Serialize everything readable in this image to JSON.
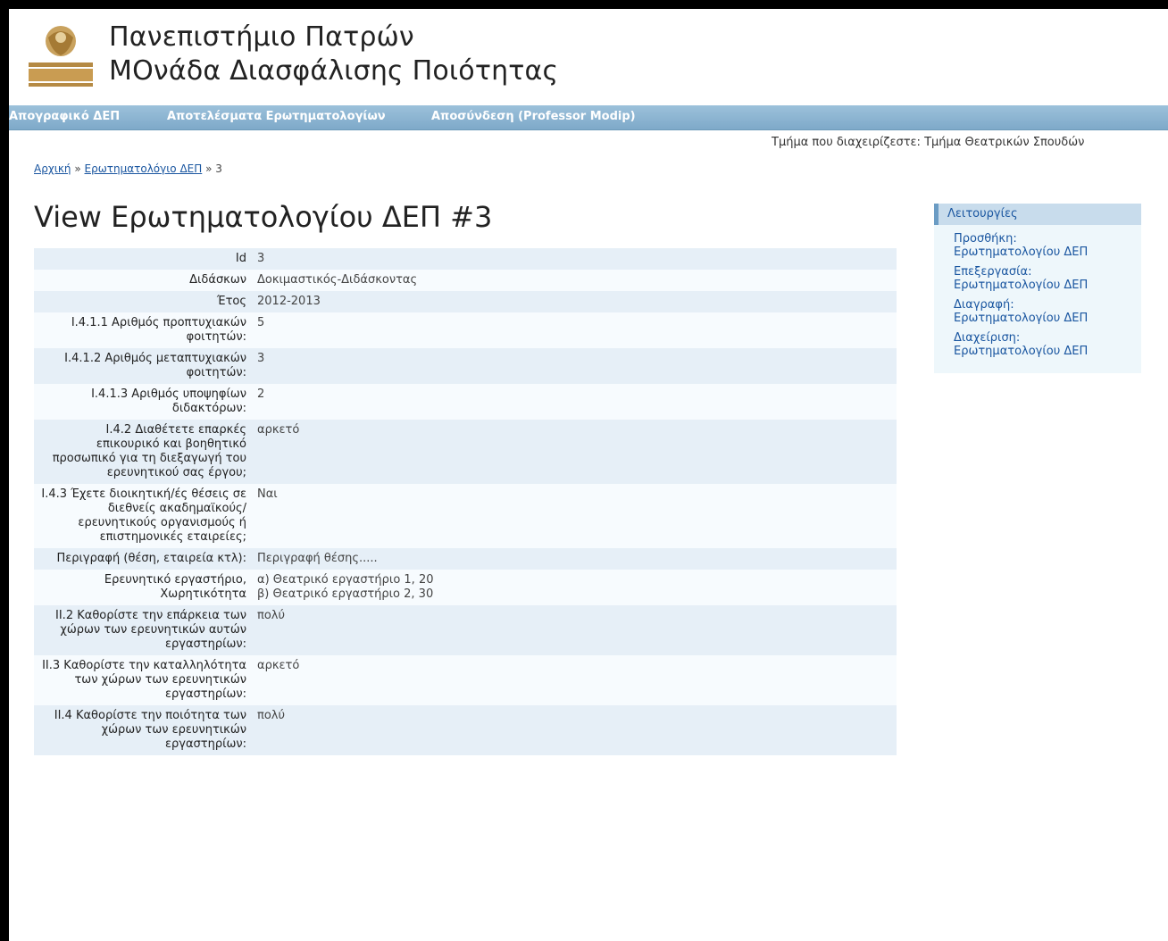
{
  "header": {
    "university": "Πανεπιστήμιο Πατρών",
    "unit": "ΜΟνάδα Διασφάλισης Ποιότητας"
  },
  "nav": [
    {
      "label": "Απογραφικό ΔΕΠ"
    },
    {
      "label": "Αποτελέσματα Ερωτηματολογίων"
    },
    {
      "label": "Αποσύνδεση (Professor Modip)"
    }
  ],
  "department": "Τμήμα που διαχειρίζεστε: Τμήμα Θεατρικών Σπουδών",
  "breadcrumb": {
    "home": "Αρχική",
    "sep1": "»",
    "section": "Ερωτηματολόγιο ΔΕΠ",
    "sep2": "»",
    "current": "3"
  },
  "page_title": "View Ερωτηματολογίου ΔΕΠ #3",
  "fields": [
    {
      "label": "Id",
      "value": [
        "3"
      ]
    },
    {
      "label": "Διδάσκων",
      "value": [
        "Δοκιμαστικός-Διδάσκοντας"
      ]
    },
    {
      "label": "Έτος",
      "value": [
        "2012-2013"
      ]
    },
    {
      "label": "Ι.4.1.1 Αριθμός προπτυχιακών φοιτητών:",
      "value": [
        "5"
      ]
    },
    {
      "label": "Ι.4.1.2 Αριθμός μεταπτυχιακών φοιτητών:",
      "value": [
        "3"
      ]
    },
    {
      "label": "Ι.4.1.3 Αριθμός υποψηφίων διδακτόρων:",
      "value": [
        "2"
      ]
    },
    {
      "label": "Ι.4.2 Διαθέτετε επαρκές επικουρικό και βοηθητικό προσωπικό για τη διεξαγωγή του ερευνητικού σας έργου;",
      "value": [
        "αρκετό"
      ]
    },
    {
      "label": "Ι.4.3 Έχετε διοικητική/ές θέσεις σε διεθνείς ακαδημαϊκούς/ ερευνητικούς οργανισμούς ή επιστημονικές εταιρείες;",
      "value": [
        "Ναι"
      ]
    },
    {
      "label": "Περιγραφή (θέση, εταιρεία κτλ):",
      "value": [
        "Περιγραφή θέσης....."
      ]
    },
    {
      "label": "Ερευνητικό εργαστήριο, Χωρητικότητα",
      "value": [
        "α) Θεατρικό εργαστήριο 1, 20",
        "β) Θεατρικό εργαστήριο 2, 30"
      ]
    },
    {
      "label": "ΙΙ.2 Καθορίστε την επάρκεια των χώρων των ερευνητικών αυτών εργαστηρίων:",
      "value": [
        "πολύ"
      ]
    },
    {
      "label": "ΙΙ.3 Καθορίστε την καταλληλότητα των χώρων των ερευνητικών εργαστηρίων:",
      "value": [
        "αρκετό"
      ]
    },
    {
      "label": "ΙΙ.4 Καθορίστε την ποιότητα των χώρων των ερευνητικών εργαστηρίων:",
      "value": [
        "πολύ"
      ]
    }
  ],
  "sidebar": {
    "title": "Λειτουργίες",
    "items": [
      {
        "line1": "Προσθήκη:",
        "line2": "Ερωτηματολογίου ΔΕΠ"
      },
      {
        "line1": "Επεξεργασία:",
        "line2": "Ερωτηματολογίου ΔΕΠ"
      },
      {
        "line1": "Διαγραφή:",
        "line2": "Ερωτηματολογίου ΔΕΠ"
      },
      {
        "line1": "Διαχείριση:",
        "line2": "Ερωτηματολογίου ΔΕΠ"
      }
    ]
  }
}
